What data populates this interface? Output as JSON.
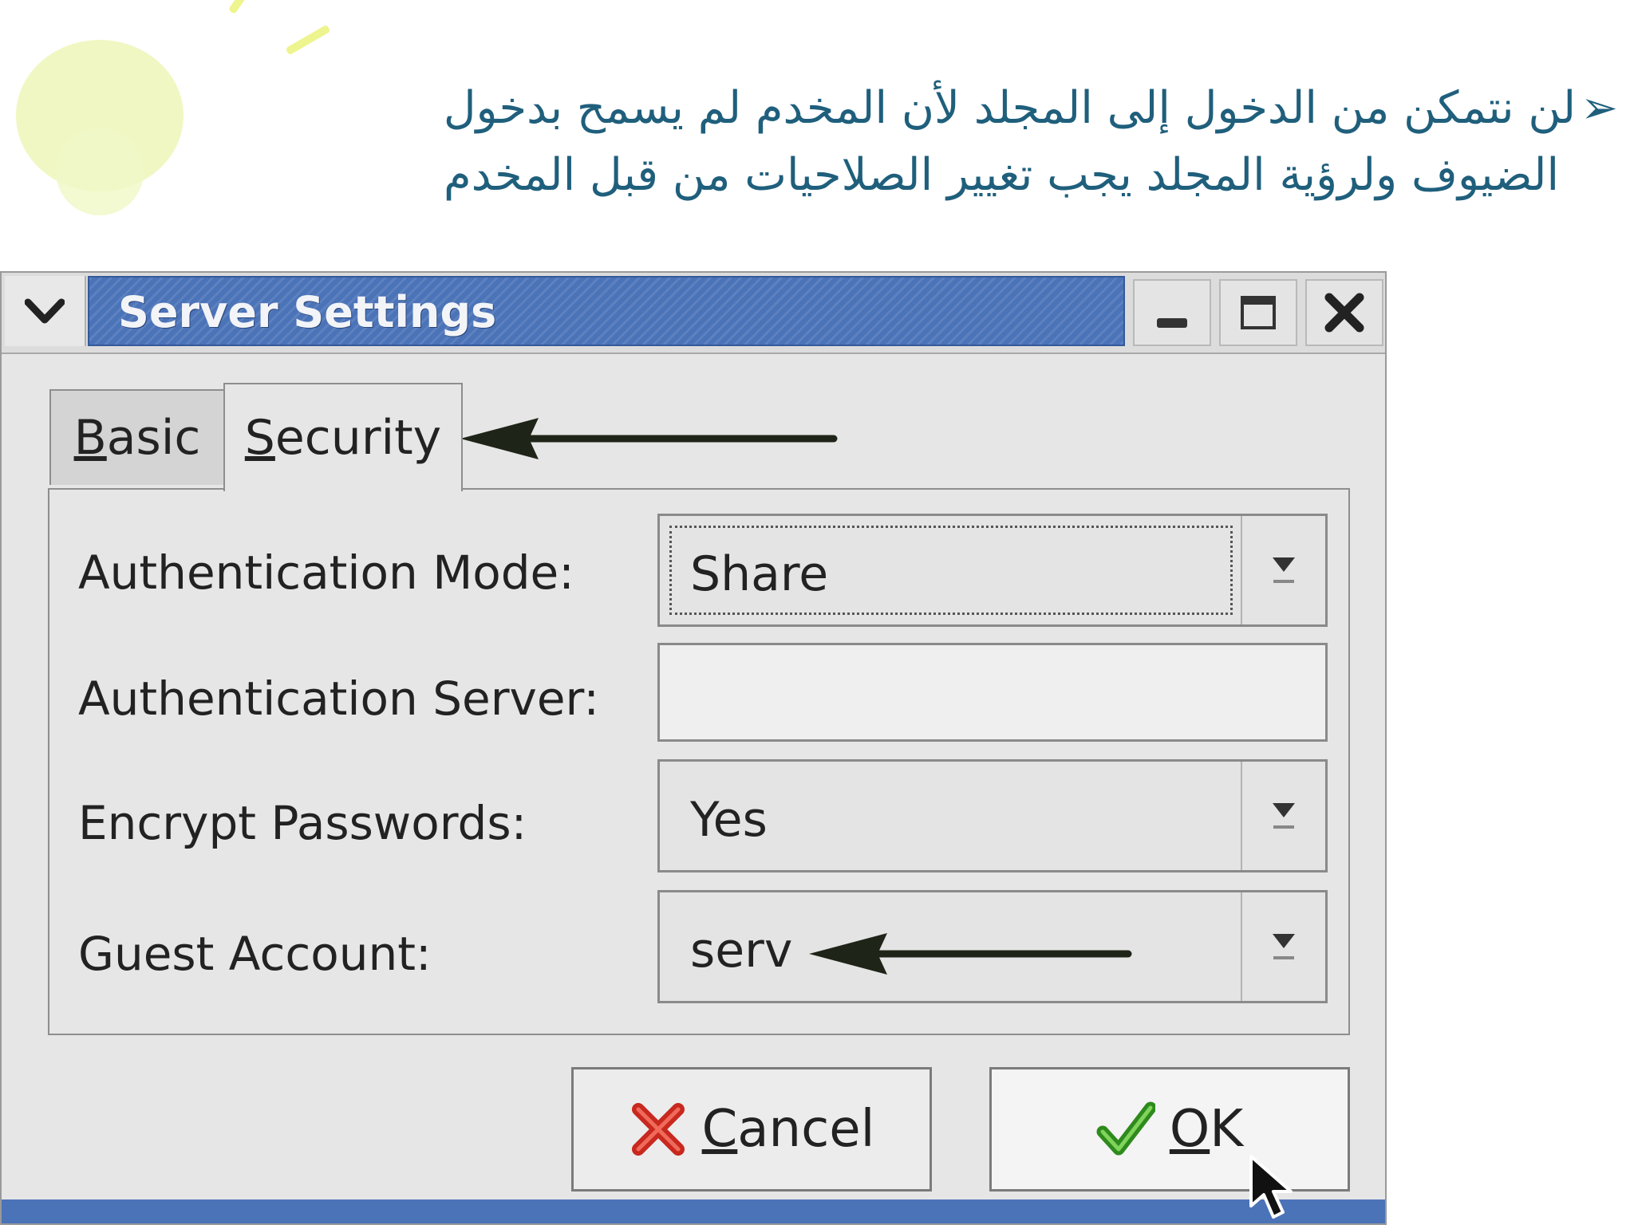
{
  "slide": {
    "caption_line1": "لن نتمكن من الدخول إلى المجلد لأن المخدم لم يسمح بدخول",
    "caption_line2": "الضيوف ولرؤية المجلد يجب تغيير الصلاحيات من قبل المخدم",
    "bullet_icon": "arrow-bullet-icon",
    "text_color": "#1f5f7c"
  },
  "window": {
    "title": "Server Settings",
    "titlebar_color": "#4b73b8",
    "menu_icon": "chevron-down-icon",
    "minimize_icon": "minimize-icon",
    "maximize_icon": "maximize-icon",
    "close_icon": "close-icon"
  },
  "tabs": [
    {
      "prefix": "B",
      "rest": "asic",
      "active": false
    },
    {
      "prefix": "S",
      "rest": "ecurity",
      "active": true
    }
  ],
  "form": {
    "auth_mode": {
      "label": "Authentication Mode:",
      "value": "Share"
    },
    "auth_server": {
      "label": "Authentication Server:",
      "value": ""
    },
    "encrypt_passwords": {
      "label": "Encrypt Passwords:",
      "value": "Yes"
    },
    "guest_account": {
      "label": "Guest Account:",
      "value": "serv"
    }
  },
  "buttons": {
    "cancel": {
      "prefix": "C",
      "rest": "ancel",
      "icon": "red-x-icon"
    },
    "ok": {
      "prefix": "O",
      "rest": "K",
      "icon": "green-check-icon"
    }
  }
}
